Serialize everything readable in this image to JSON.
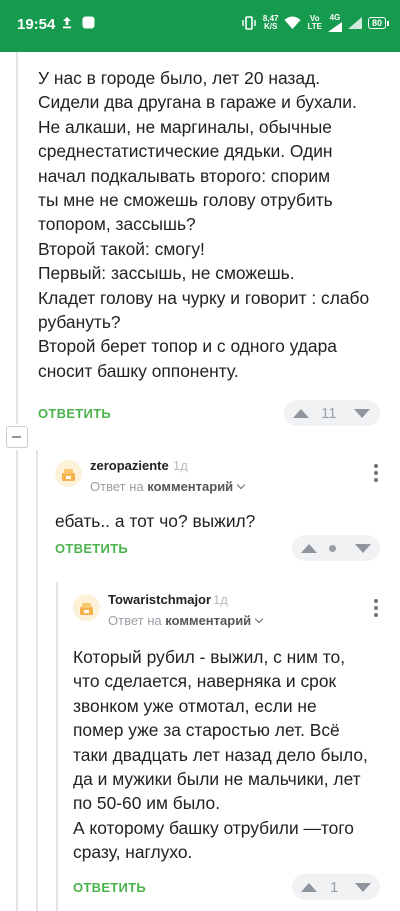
{
  "status_bar": {
    "time": "19:54",
    "speed_value": "8,47",
    "speed_unit": "K/S",
    "net_vo": "Vo",
    "net_lte": "LTE",
    "net_4g": "4G",
    "battery": "80"
  },
  "comments": [
    {
      "lines": [
        "У нас в городе было, лет 20 назад.",
        "Сидели два другана в гараже и бухали.",
        "Не алкаши, не маргиналы, обычные",
        "среднестатистические дядьки. Один",
        "начал подкалывать второго: спорим",
        "ты мне не сможешь голову отрубить",
        "топором, зассышь?",
        "Второй такой: смогу!",
        "Первый: зассышь, не сможешь.",
        "Кладет голову на чурку и говорит : слабо",
        "рубануть?",
        "Второй берет топор и с одного удара",
        "сносит башку оппоненту."
      ],
      "reply_label": "ОТВЕТИТЬ",
      "votes": "11"
    },
    {
      "username": "zeropaziente",
      "time_ago": "1д",
      "reply_to_prefix": "Ответ на",
      "reply_to_target": "комментарий",
      "lines": [
        "ебать.. а тот чо? выжил?"
      ],
      "reply_label": "ОТВЕТИТЬ"
    },
    {
      "username": "Towaristchmajor",
      "time_ago": "1д",
      "reply_to_prefix": "Ответ на",
      "reply_to_target": "комментарий",
      "lines": [
        "Который рубил - выжил, с ним то,",
        "что сделается, наверняка и срок",
        "звонком уже отмотал, если не",
        "помер уже за старостью лет. Всё",
        "таки двадцать лет назад дело было,",
        "да и мужики были не мальчики, лет",
        "по 50-60 им было.",
        "А которому башку отрубили —того",
        "сразу, наглухо."
      ],
      "reply_label": "ОТВЕТИТЬ",
      "votes": "1"
    }
  ],
  "colors": {
    "status_bar": "#169a4e",
    "reply_green": "#4bb34b",
    "vote_bg": "#f1f2f4"
  }
}
